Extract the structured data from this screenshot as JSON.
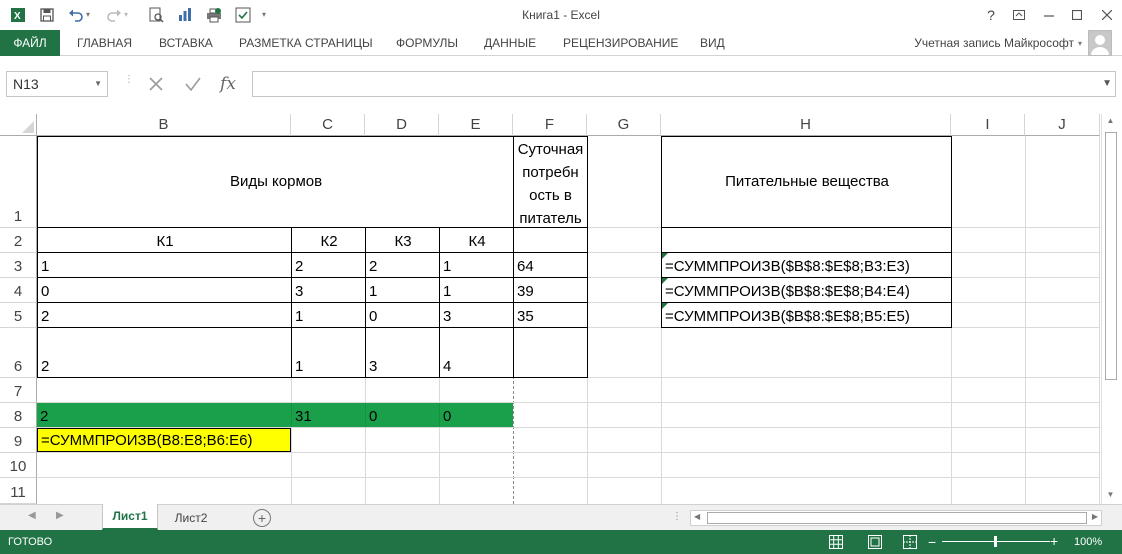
{
  "window": {
    "title": "Книга1 - Excel",
    "help_icon": "question-icon",
    "minimize_icon": "minimize-icon",
    "restore_icon": "restore-icon",
    "close_icon": "close-icon"
  },
  "ribbon": {
    "tabs": [
      "ФАЙЛ",
      "ГЛАВНАЯ",
      "ВСТАВКА",
      "РАЗМЕТКА СТРАНИЦЫ",
      "ФОРМУЛЫ",
      "ДАННЫЕ",
      "РЕЦЕНЗИРОВАНИЕ",
      "ВИД"
    ],
    "account_label": "Учетная запись Майкрософт"
  },
  "formula_bar": {
    "name_box": "N13",
    "formula": "",
    "fx_label": "fx"
  },
  "columns": [
    "B",
    "C",
    "D",
    "E",
    "F",
    "G",
    "H",
    "I",
    "J"
  ],
  "rows": [
    "1",
    "2",
    "3",
    "4",
    "5",
    "6",
    "7",
    "8",
    "9",
    "10",
    "11"
  ],
  "cells": {
    "B1": "Виды кормов",
    "F1": "Суточная потребн ость в питатель",
    "H1": "Питательные вещества",
    "B2": "К1",
    "C2": "К2",
    "D2": "К3",
    "E2": "К4",
    "B3": "1",
    "C3": "2",
    "D3": "2",
    "E3": "1",
    "F3": "64",
    "B4": "0",
    "C4": "3",
    "D4": "1",
    "E4": "1",
    "F4": "39",
    "B5": "2",
    "C5": "1",
    "D5": "0",
    "E5": "3",
    "F5": "35",
    "B6": "2",
    "C6": "1",
    "D6": "3",
    "E6": "4",
    "B8": "2",
    "C8": "31",
    "D8": "0",
    "E8": "0",
    "B9": "=СУММПРОИЗВ(B8:E8;B6:E6)",
    "H3": "=СУММПРОИЗВ($B$8:$E$8;B3:E3)",
    "H4": "=СУММПРОИЗВ($B$8:$E$8;B4:E4)",
    "H5": "=СУММПРОИЗВ($B$8:$E$8;B5:E5)"
  },
  "sheets": {
    "active": "Лист1",
    "other": "Лист2"
  },
  "status": {
    "text": "ГОТОВО",
    "zoom": "100%"
  },
  "colors": {
    "accent": "#217346",
    "highlight_green": "#1aa04a",
    "highlight_yellow": "#ffff00"
  }
}
